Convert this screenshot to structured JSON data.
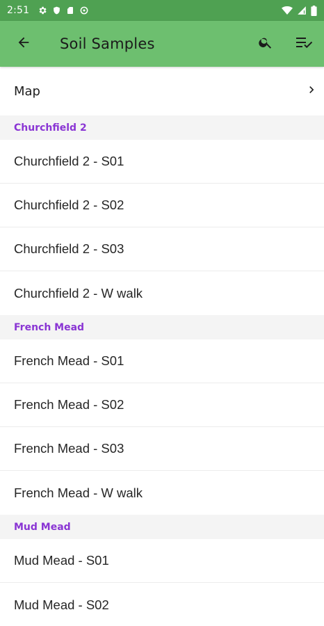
{
  "status_bar": {
    "time": "2:51",
    "icons_left": [
      "gear-icon",
      "shield-icon",
      "sd-card-icon",
      "data-saver-icon"
    ],
    "icons_right": [
      "wifi-icon",
      "signal-icon",
      "battery-icon"
    ]
  },
  "app_bar": {
    "title": "Soil Samples",
    "background": "#6dbf6f",
    "nav_icon": "arrow-back-icon",
    "actions": [
      "search-icon",
      "filter-list-icon"
    ]
  },
  "map_row": {
    "label": "Map"
  },
  "sections": [
    {
      "header": "Churchfield 2",
      "items": [
        "Churchfield 2 - S01",
        "Churchfield 2 - S02",
        "Churchfield 2 - S03",
        "Churchfield 2 - W walk"
      ]
    },
    {
      "header": "French Mead",
      "items": [
        "French Mead - S01",
        "French Mead - S02",
        "French Mead - S03",
        "French Mead - W walk"
      ]
    },
    {
      "header": "Mud Mead",
      "items": [
        "Mud Mead - S01",
        "Mud Mead - S02"
      ]
    }
  ],
  "colors": {
    "status_bar": "#4fa152",
    "section_header_text": "#8a35d4",
    "section_header_bg": "#f4f4f4"
  }
}
